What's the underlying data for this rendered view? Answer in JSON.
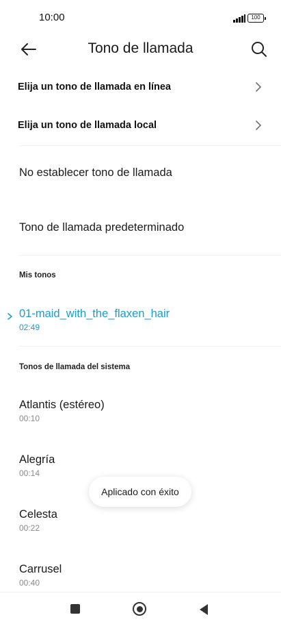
{
  "status_bar": {
    "time": "10:00",
    "battery": "100"
  },
  "header": {
    "title": "Tono de llamada"
  },
  "nav_rows": [
    {
      "label": "Elija un tono de llamada en línea"
    },
    {
      "label": "Elija un tono de llamada local"
    }
  ],
  "plain_rows": [
    {
      "label": "No establecer tono de llamada"
    },
    {
      "label": "Tono de llamada predeterminado"
    }
  ],
  "my_tones": {
    "heading": "Mis tonos",
    "items": [
      {
        "name": "01-maid_with_the_flaxen_hair",
        "duration": "02:49",
        "selected": true
      }
    ]
  },
  "system_tones": {
    "heading": "Tonos de llamada del sistema",
    "items": [
      {
        "name": "Atlantis (estéreo)",
        "duration": "00:10"
      },
      {
        "name": "Alegría",
        "duration": "00:14"
      },
      {
        "name": "Celesta",
        "duration": "00:22"
      },
      {
        "name": "Carrusel",
        "duration": "00:40"
      }
    ]
  },
  "toast": {
    "text": "Aplicado con éxito"
  },
  "colors": {
    "accent": "#1a9bd1"
  },
  "icons": [
    "back-arrow-icon",
    "search-icon",
    "chevron-right-icon",
    "recents-icon",
    "home-icon",
    "back-triangle-icon"
  ]
}
